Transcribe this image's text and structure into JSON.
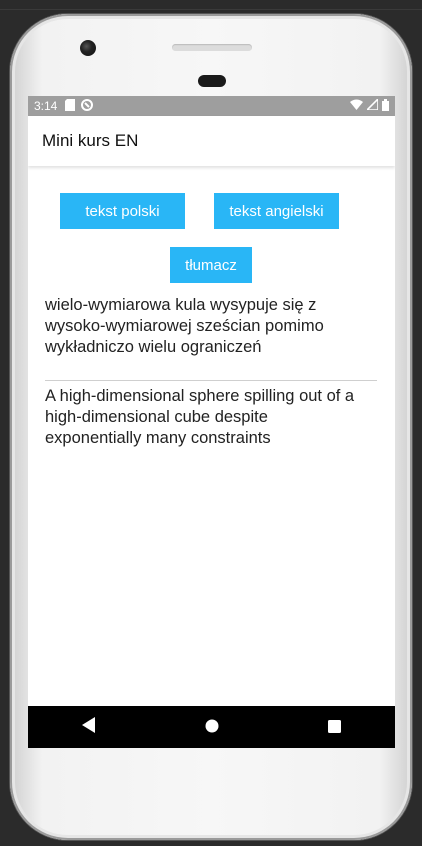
{
  "status_bar": {
    "time": "3:14"
  },
  "app_bar": {
    "title": "Mini kurs EN"
  },
  "buttons": {
    "polish_text": "tekst polski",
    "english_text": "tekst angielski",
    "translate": "tłumacz"
  },
  "texts": {
    "polish": "wielo-wymiarowa kula wysypuje się z wysoko-wymiarowej sześcian pomimo wykładniczo wielu ograniczeń",
    "english": "A high-dimensional sphere spilling out of a high-dimensional cube despite exponentially many constraints"
  },
  "colors": {
    "accent": "#29b6f6",
    "status_bar": "#9e9e9e",
    "nav_bar": "#000000"
  },
  "icons": {
    "status_left": [
      "sd-card-icon",
      "sync-icon"
    ],
    "status_right": [
      "wifi-icon",
      "signal-icon",
      "battery-icon"
    ],
    "nav": [
      "back-icon",
      "home-icon",
      "recents-icon"
    ]
  }
}
